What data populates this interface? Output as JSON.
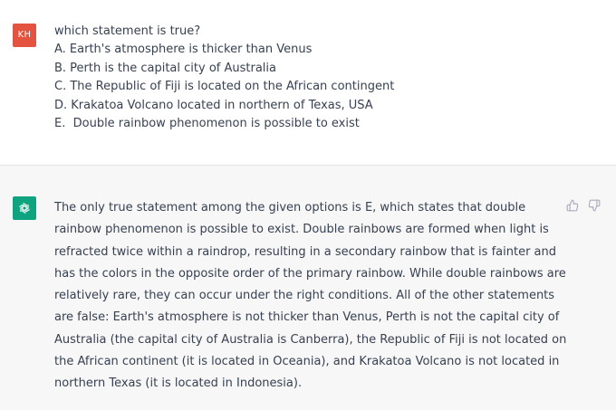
{
  "user_message": {
    "avatar_initials": "KH",
    "avatar_color": "#e4533f",
    "lines": [
      "which statement is true?",
      "A. Earth's atmosphere is thicker than Venus",
      "B. Perth is the capital city of Australia",
      "C. The Republic of Fiji is located on the African contingent",
      "D. Krakatoa Volcano located in northern of Texas, USA",
      "E.  Double rainbow phenomenon is possible to exist"
    ]
  },
  "assistant_message": {
    "avatar_icon": "chatgpt-logo-icon",
    "avatar_color": "#10a37f",
    "lines": [
      "The only true statement among the given options is E, which states that double",
      "rainbow phenomenon is possible to exist. Double rainbows are formed when light is",
      "refracted twice within a raindrop, resulting in a secondary rainbow that is fainter and",
      "has the colors in the opposite order of the primary rainbow. While double rainbows are",
      "relatively rare, they can occur under the right conditions. All of the other statements",
      "are false: Earth's atmosphere is not thicker than Venus, Perth is not the capital city of",
      "Australia (the capital city of Australia is Canberra), the Republic of Fiji is not located on",
      "the African continent (it is located in Oceania), and Krakatoa Volcano is not located in",
      "northern Texas (it is located in Indonesia)."
    ],
    "feedback_icons": [
      "thumbs-up-icon",
      "thumbs-down-icon"
    ]
  }
}
